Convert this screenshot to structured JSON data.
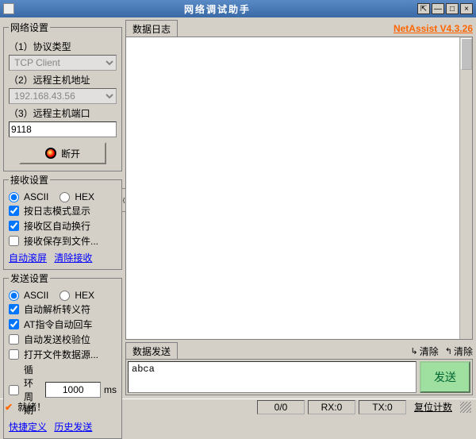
{
  "title": "网络调试助手",
  "version_label": "NetAssist V4.3.26",
  "net_settings": {
    "legend": "网络设置",
    "protocol_label": "（1）协议类型",
    "protocol_value": "TCP Client",
    "host_label": "（2）远程主机地址",
    "host_value": "192.168.43.56",
    "port_label": "（3）远程主机端口",
    "port_value": "9118",
    "disconnect_label": "断开"
  },
  "recv_settings": {
    "legend": "接收设置",
    "ascii": "ASCII",
    "hex": "HEX",
    "opt_log": "按日志模式显示",
    "opt_wrap": "接收区自动换行",
    "opt_save": "接收保存到文件...",
    "link_autoscroll": "自动滚屏",
    "link_clear": "清除接收"
  },
  "send_settings": {
    "legend": "发送设置",
    "ascii": "ASCII",
    "hex": "HEX",
    "opt_escape": "自动解析转义符",
    "opt_atcr": "AT指令自动回车",
    "opt_checksum": "自动发送校验位",
    "opt_openfile": "打开文件数据源...",
    "opt_period_label": "循环周期",
    "opt_period_value": "1000",
    "opt_period_unit": "ms",
    "link_shortcut": "快捷定义",
    "link_history": "历史发送"
  },
  "log_tab": "数据日志",
  "send_tab": "数据发送",
  "send_clear1": "清除",
  "send_clear2": "清除",
  "send_input_value": "abca",
  "send_button": "发送",
  "status": {
    "ready": "就绪！",
    "counter": "0/0",
    "rx": "RX:0",
    "tx": "TX:0",
    "reset": "复位计数"
  }
}
